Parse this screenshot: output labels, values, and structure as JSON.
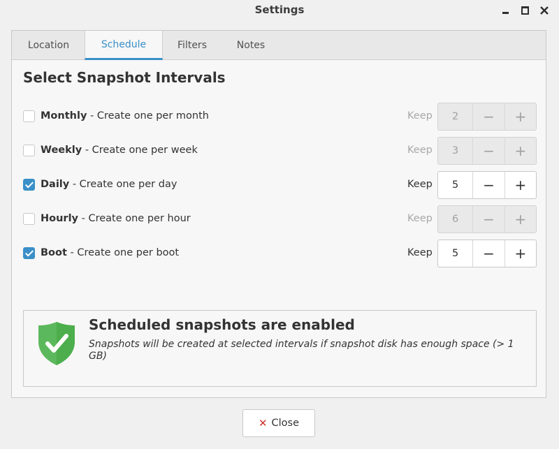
{
  "window": {
    "title": "Settings"
  },
  "tabs": [
    {
      "label": "Location",
      "active": false
    },
    {
      "label": "Schedule",
      "active": true
    },
    {
      "label": "Filters",
      "active": false
    },
    {
      "label": "Notes",
      "active": false
    }
  ],
  "heading": "Select Snapshot Intervals",
  "intervals": [
    {
      "name": "Monthly",
      "desc": " - Create one per month",
      "checked": false,
      "keep_label": "Keep",
      "count": "2"
    },
    {
      "name": "Weekly",
      "desc": " - Create one per week",
      "checked": false,
      "keep_label": "Keep",
      "count": "3"
    },
    {
      "name": "Daily",
      "desc": " - Create one per day",
      "checked": true,
      "keep_label": "Keep",
      "count": "5"
    },
    {
      "name": "Hourly",
      "desc": " - Create one per hour",
      "checked": false,
      "keep_label": "Keep",
      "count": "6"
    },
    {
      "name": "Boot",
      "desc": " - Create one per boot",
      "checked": true,
      "keep_label": "Keep",
      "count": "5"
    }
  ],
  "spinner": {
    "minus": "−",
    "plus": "+"
  },
  "status": {
    "title": "Scheduled snapshots are enabled",
    "text": "Snapshots will be created at selected intervals if snapshot disk has enough space (> 1 GB)",
    "icon": "shield-check-icon",
    "icon_color": "#5cb85c"
  },
  "footer": {
    "close_label": "Close",
    "close_icon": "close-x-icon"
  },
  "colors": {
    "accent": "#3a8fc8",
    "close_icon": "#d0312d"
  }
}
